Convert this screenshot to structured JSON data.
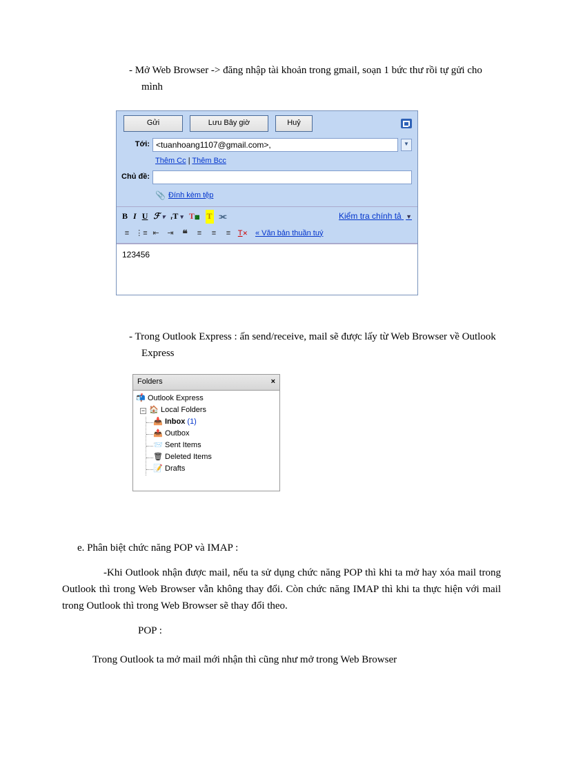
{
  "doc": {
    "bullet1": "Mở Web Browser -> đăng nhập tài khoản trong gmail, soạn 1 bức thư rồi tự gửi cho mình",
    "bullet2": "Trong Outlook Express : ấn send/receive, mail sẽ được lấy từ Web Browser về Outlook Express",
    "section_e": "e.  Phân biệt chức năng POP và IMAP :",
    "para1": "-Khi Outlook nhận được mail, nếu ta sử dụng chức năng POP thì khi ta mở hay xóa mail trong Outlook thì trong Web Browser vẫn không thay đổi. Còn chức năng IMAP thì khi ta thực hiện với mail trong Outlook thì trong Web Browser sẽ thay đổi theo.",
    "pop_label": "POP :",
    "para2": "Trong Outlook ta mở mail mới nhận thì cũng như mở trong Web Browser"
  },
  "gmail": {
    "send": "Gửi",
    "save_now": "Lưu Bây giờ",
    "cancel": "Huỷ",
    "to_label": "Tới:",
    "to_value": "<tuanhoang1107@gmail.com>,",
    "add_cc": "Thêm Cc",
    "add_bcc": "Thêm Bcc",
    "subject_label": "Chủ đề:",
    "subject_value": "",
    "attach": "Đính kèm tệp",
    "spellcheck": "Kiểm tra chính tả",
    "plain_text": "« Văn bản thuần tuý",
    "body": "123456",
    "toolbar1": {
      "f_style": "F",
      "t_size": "rT",
      "t_hi": "T",
      "chain": "🔗"
    }
  },
  "outlook": {
    "pane_title": "Folders",
    "root": "Outlook Express",
    "local": "Local Folders",
    "items": {
      "inbox": "Inbox",
      "inbox_count": "(1)",
      "outbox": "Outbox",
      "sent": "Sent Items",
      "deleted": "Deleted Items",
      "drafts": "Drafts"
    }
  }
}
